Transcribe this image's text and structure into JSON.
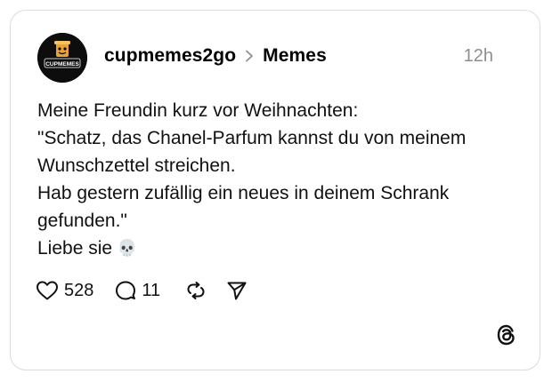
{
  "post": {
    "username": "cupmemes2go",
    "community": "Memes",
    "time": "12h",
    "avatar_text": "CUPMEMES",
    "lines": [
      "Meine Freundin kurz vor Weihnachten:",
      "\"Schatz, das Chanel-Parfum kannst du von meinem",
      "Wunschzettel streichen.",
      "Hab gestern zufällig ein neues in deinem Schrank",
      "gefunden.\"",
      "Liebe sie"
    ],
    "emoji": "💀",
    "likes": "528",
    "comments": "11"
  },
  "icons": {
    "like": "heart-icon",
    "comment": "comment-icon",
    "repost": "repost-icon",
    "share": "share-icon",
    "brand": "threads-logo-icon",
    "separator": "chevron-right-icon"
  },
  "colors": {
    "border": "#dcdcdc",
    "muted": "#8e8e8e",
    "text": "#111111",
    "avatar_bg": "#0d0d0d",
    "avatar_accent": "#e9a23b"
  }
}
